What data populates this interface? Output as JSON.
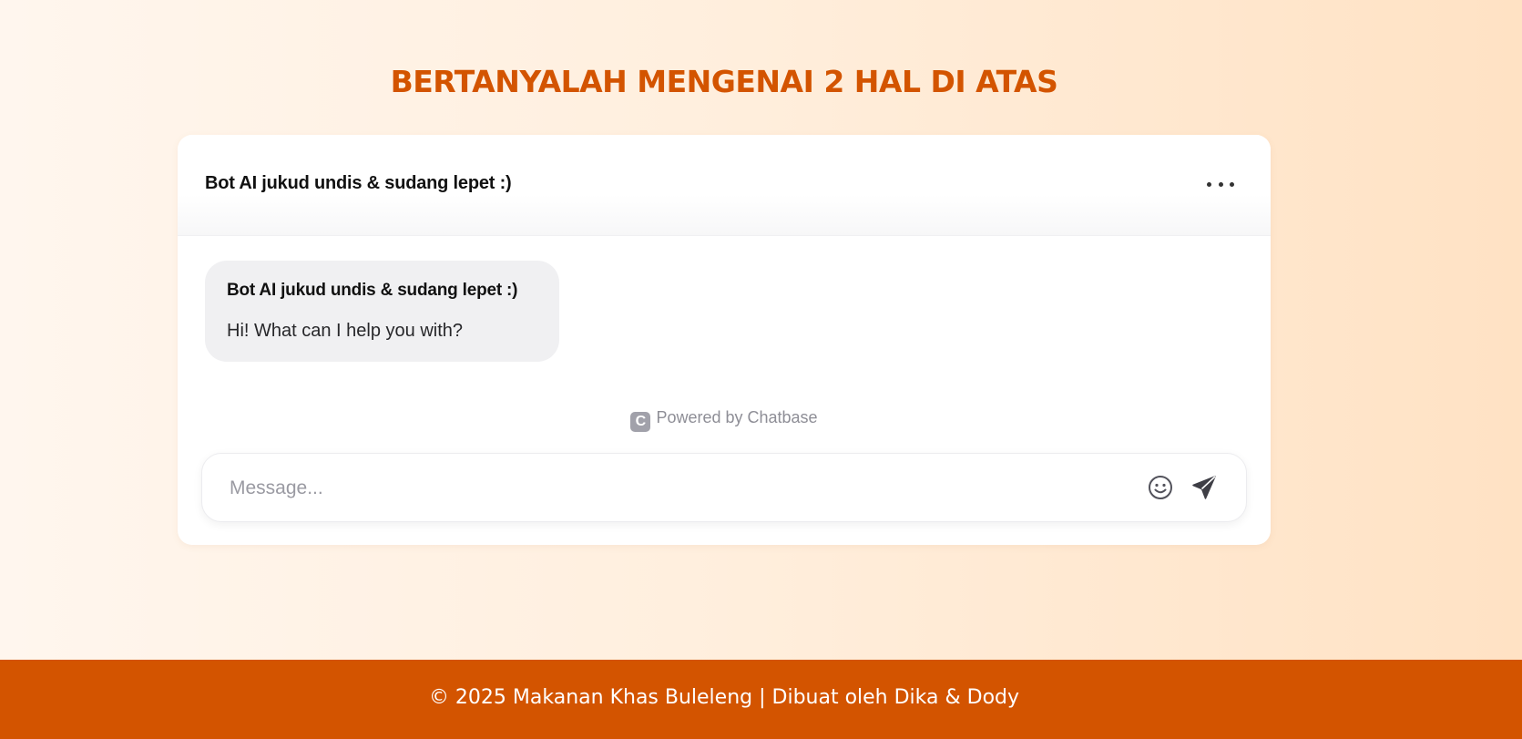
{
  "page": {
    "title": "BERTANYALAH MENGENAI 2 HAL DI ATAS"
  },
  "chat": {
    "header_title": "Bot AI jukud undis & sudang lepet :)",
    "messages": [
      {
        "sender": "Bot AI jukud undis & sudang lepet :)",
        "text": "Hi! What can I help you with?"
      }
    ],
    "powered_by": {
      "logo_letter": "C",
      "text": "Powered by Chatbase"
    },
    "composer": {
      "placeholder": "Message...",
      "value": ""
    },
    "icons": {
      "more": "more-horizontal-icon",
      "emoji": "smiley-face-icon",
      "send": "paper-plane-icon"
    }
  },
  "footer": {
    "text": "© 2025 Makanan Khas Buleleng | Dibuat oleh Dika & Dody"
  },
  "colors": {
    "accent": "#d35400",
    "page_gradient_start": "#fff6ee",
    "page_gradient_end": "#ffe2c4",
    "bubble_background": "#f0f0f2"
  }
}
